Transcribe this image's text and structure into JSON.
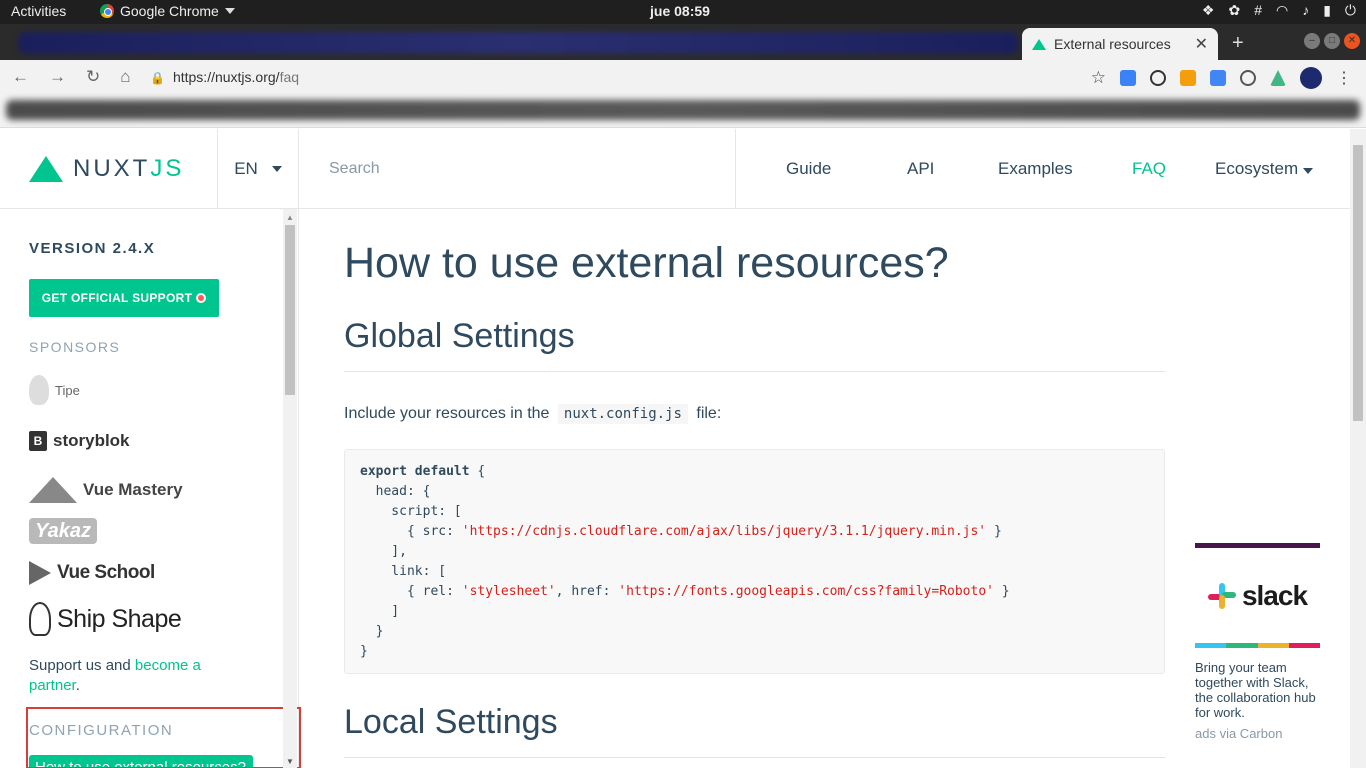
{
  "os": {
    "activities": "Activities",
    "app_name": "Google Chrome",
    "clock": "jue 08:59"
  },
  "browser": {
    "tab_title": "External resources",
    "url_host": "https://nuxtjs.org/",
    "url_path": "faq"
  },
  "site": {
    "logo_text_a": "NUXT",
    "logo_text_b": "JS",
    "lang": "EN",
    "search_placeholder": "Search",
    "nav": [
      {
        "label": "Guide"
      },
      {
        "label": "API"
      },
      {
        "label": "Examples"
      },
      {
        "label": "FAQ"
      },
      {
        "label": "Ecosystem"
      }
    ],
    "accent": "#00c58e"
  },
  "sidebar": {
    "version": "VERSION 2.4.X",
    "support_button": "GET OFFICIAL SUPPORT",
    "sponsors_heading": "SPONSORS",
    "sponsors": {
      "tipe": "Tipe",
      "storyblok": "storyblok",
      "vue_mastery": "Vue Mastery",
      "yakaz": "Yakaz",
      "vue_school": "Vue School",
      "ship_shape": "Ship Shape"
    },
    "support_text": "Support us and ",
    "support_link": "become a partner",
    "support_end": ".",
    "config_heading": "CONFIGURATION",
    "active_item": "How to use external resources?"
  },
  "content": {
    "title": "How to use external resources?",
    "section1": "Global Settings",
    "para_before": "Include your resources in the",
    "para_code": "nuxt.config.js",
    "para_after": "file:",
    "section2": "Local Settings",
    "code": {
      "l1_kw": "export default",
      "l1_rest": " {",
      "l2": "  head: {",
      "l3": "    script: [",
      "l4_a": "      { src: ",
      "l4_str": "'https://cdnjs.cloudflare.com/ajax/libs/jquery/3.1.1/jquery.min.js'",
      "l4_b": " }",
      "l5": "    ],",
      "l6": "    link: [",
      "l7_a": "      { rel: ",
      "l7_str1": "'stylesheet'",
      "l7_b": ", href: ",
      "l7_str2": "'https://fonts.googleapis.com/css?family=Roboto'",
      "l7_c": " }",
      "l8": "    ]",
      "l9": "  }",
      "l10": "}"
    }
  },
  "ad": {
    "brand": "slack",
    "text": "Bring your team together with Slack, the collaboration hub for work.",
    "via": "ads via Carbon"
  }
}
